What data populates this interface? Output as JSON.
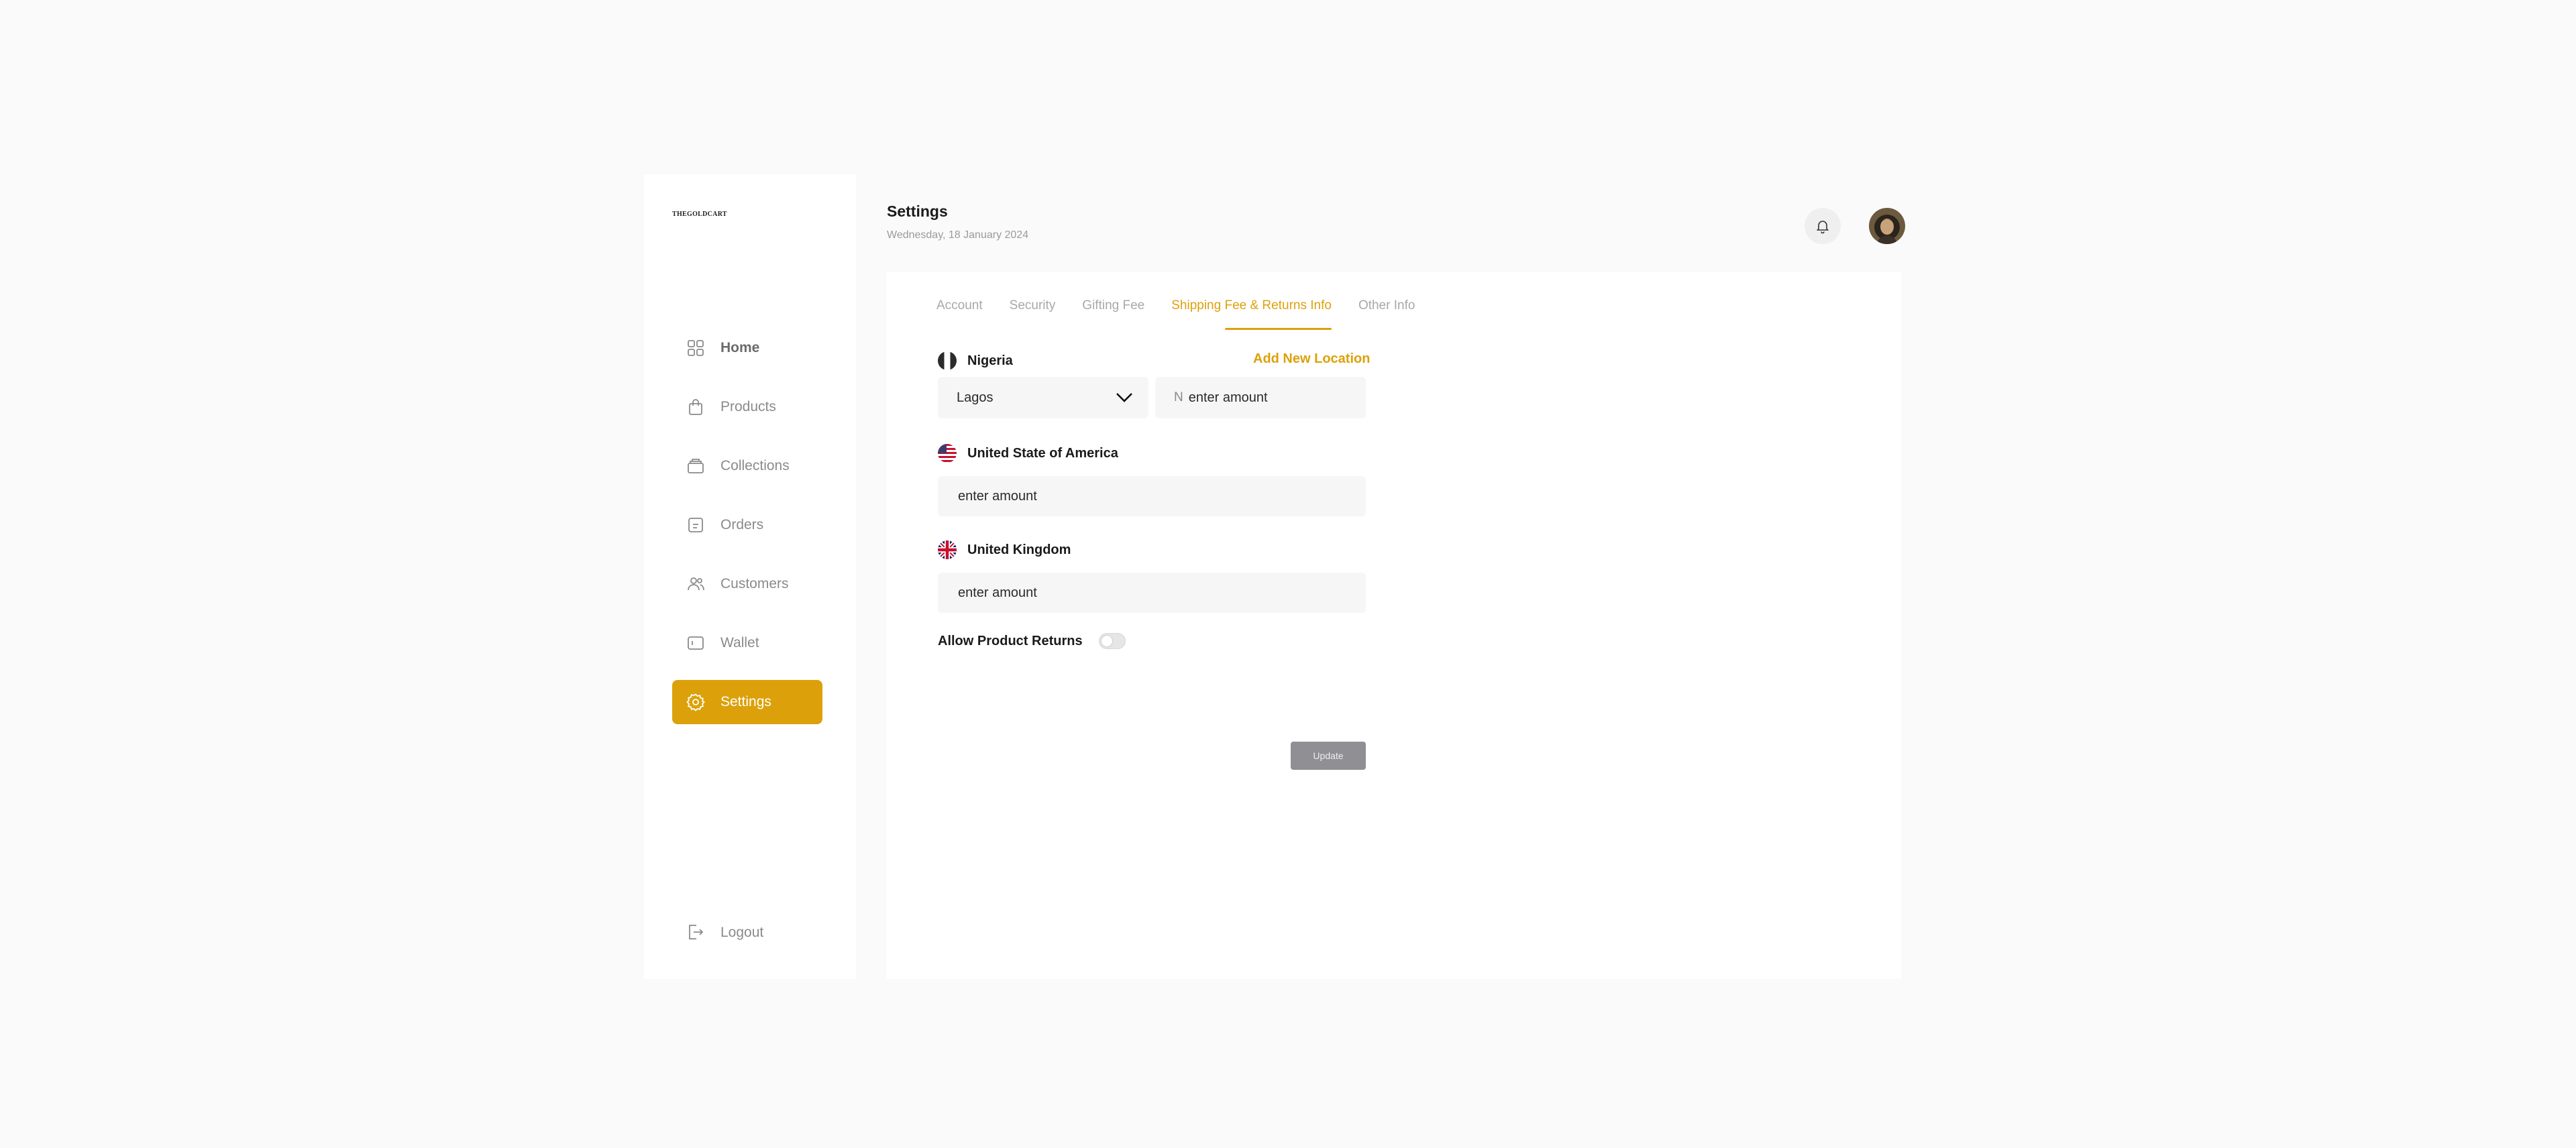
{
  "brand": {
    "name": "THEGOLDCART"
  },
  "sidebar": {
    "items": [
      {
        "label": "Home",
        "icon": "grid-icon"
      },
      {
        "label": "Products",
        "icon": "bag-icon"
      },
      {
        "label": "Collections",
        "icon": "collections-icon"
      },
      {
        "label": "Orders",
        "icon": "orders-icon"
      },
      {
        "label": "Customers",
        "icon": "users-icon"
      },
      {
        "label": "Wallet",
        "icon": "wallet-icon"
      },
      {
        "label": "Settings",
        "icon": "gear-icon"
      }
    ],
    "active": "Settings",
    "logout_label": "Logout"
  },
  "header": {
    "title": "Settings",
    "date": "Wednesday, 18 January 2024"
  },
  "tabs": [
    {
      "label": "Account"
    },
    {
      "label": "Security"
    },
    {
      "label": "Gifting Fee"
    },
    {
      "label": "Shipping Fee & Returns Info"
    },
    {
      "label": "Other Info"
    }
  ],
  "active_tab": "Shipping Fee & Returns Info",
  "shipping": {
    "add_location_label": "Add New Location",
    "nigeria": {
      "country": "Nigeria",
      "city_selected": "Lagos",
      "currency_symbol": "N",
      "amount_placeholder": "enter amount"
    },
    "usa": {
      "country": "United State of America",
      "amount_placeholder": "enter amount"
    },
    "uk": {
      "country": "United Kingdom",
      "amount_placeholder": "enter amount"
    }
  },
  "returns": {
    "label": "Allow Product Returns",
    "enabled": false
  },
  "update_label": "Update",
  "colors": {
    "accent": "#dca10a",
    "button_disabled": "#8f8f94",
    "input_bg": "#f6f6f6"
  }
}
